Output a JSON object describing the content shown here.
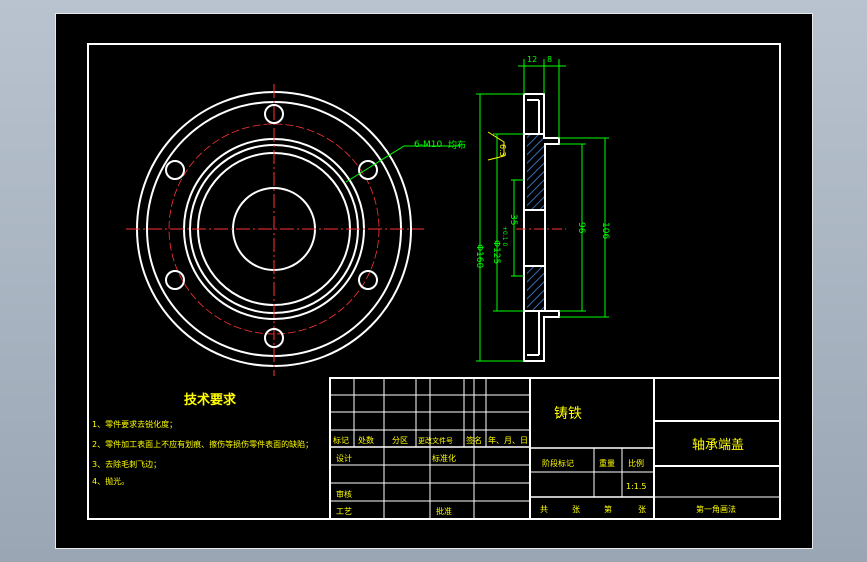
{
  "colors": {
    "background": "#000000",
    "line": "#ffffff",
    "dimension": "#00ff00",
    "note": "#ffff00",
    "hatch": "#3a6ab4",
    "page": "#a9b4c1"
  },
  "front_view": {
    "hole_note": "6-M10",
    "hole_note_suffix": "均布"
  },
  "side_view": {
    "dim_top_a": "12",
    "dim_top_b": "8",
    "dim_outer": "Φ160",
    "dim_bolt_circle": "Φ125",
    "dim_bore": "35",
    "dim_bore_tol": "+0.1 0",
    "dim_inner": "96",
    "dim_boss": "106",
    "roughness": "6.3"
  },
  "tech_requirements": {
    "title": "技术要求",
    "items": [
      "1、零件要求去锐化度；",
      "2、零件加工表面上不应有划痕、擦伤等损伤零件表面的缺陷；",
      "3、去除毛刺飞边；",
      "4、抛光。"
    ]
  },
  "title_block": {
    "material": "铸铁",
    "part_name": "轴承端盖",
    "revision_headers": [
      "标记",
      "处数",
      "分区",
      "更改文件号",
      "签名",
      "年、月、日"
    ],
    "design_label": "设计",
    "standardize_label": "标准化",
    "review_label": "审核",
    "process_label": "工艺",
    "approve_label": "批准",
    "stage_mark_label": "阶段标记",
    "weight_label": "重量",
    "scale_label": "比例",
    "scale_value": "1:1.5",
    "sheet_total": "共",
    "sheet_unit_1": "张",
    "sheet_current": "第",
    "sheet_unit_2": "张",
    "projection": "第一角画法"
  }
}
